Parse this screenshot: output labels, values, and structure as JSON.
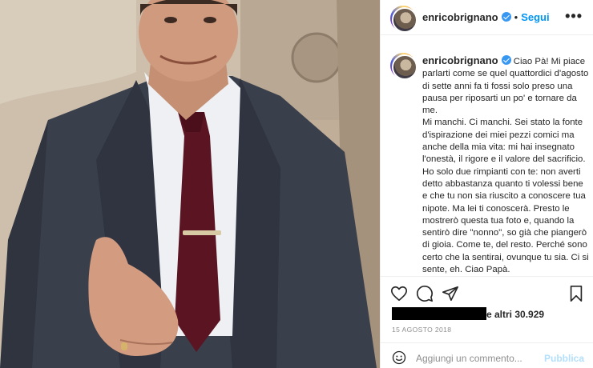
{
  "post": {
    "username": "enricobrignano",
    "follow_label": "Segui",
    "more_label": "•••",
    "caption": "Ciao Pà! Mi piace parlarti come se quel quattordici d'agosto di sette anni fa ti fossi solo preso una pausa per riposarti un po' e tornare da me.\nMi manchi. Ci manchi. Sei stato la fonte d'ispirazione dei miei pezzi comici ma anche della mia vita: mi hai insegnato l'onestà, il rigore e il valore del sacrificio. Ho solo due rimpianti con te: non averti detto abbastanza quanto ti volessi bene e che tu non sia riuscito a conoscere tua nipote. Ma lei ti conoscerà. Presto le mostrerò questa tua foto e, quando la sentirò dire \"nonno\", so già che piangerò di gioia. Come te, del resto. Perché sono certo che la sentirai, ovunque tu sia. Ci si sente, eh. Ciao Papà.",
    "likes_text": "e altri 30.929",
    "date": "15 AGOSTO 2018",
    "comment_placeholder": "Aggiungi un commento...",
    "publish_label": "Pubblica",
    "verified": true
  },
  "icons": {
    "like": "heart-icon",
    "comment": "comment-icon",
    "share": "paper-plane-icon",
    "save": "bookmark-icon",
    "emoji": "smiley-icon"
  },
  "colors": {
    "link": "#0095f6",
    "verified": "#3897f0",
    "muted": "#8e8e8e",
    "publish_disabled": "#b2dffc"
  }
}
